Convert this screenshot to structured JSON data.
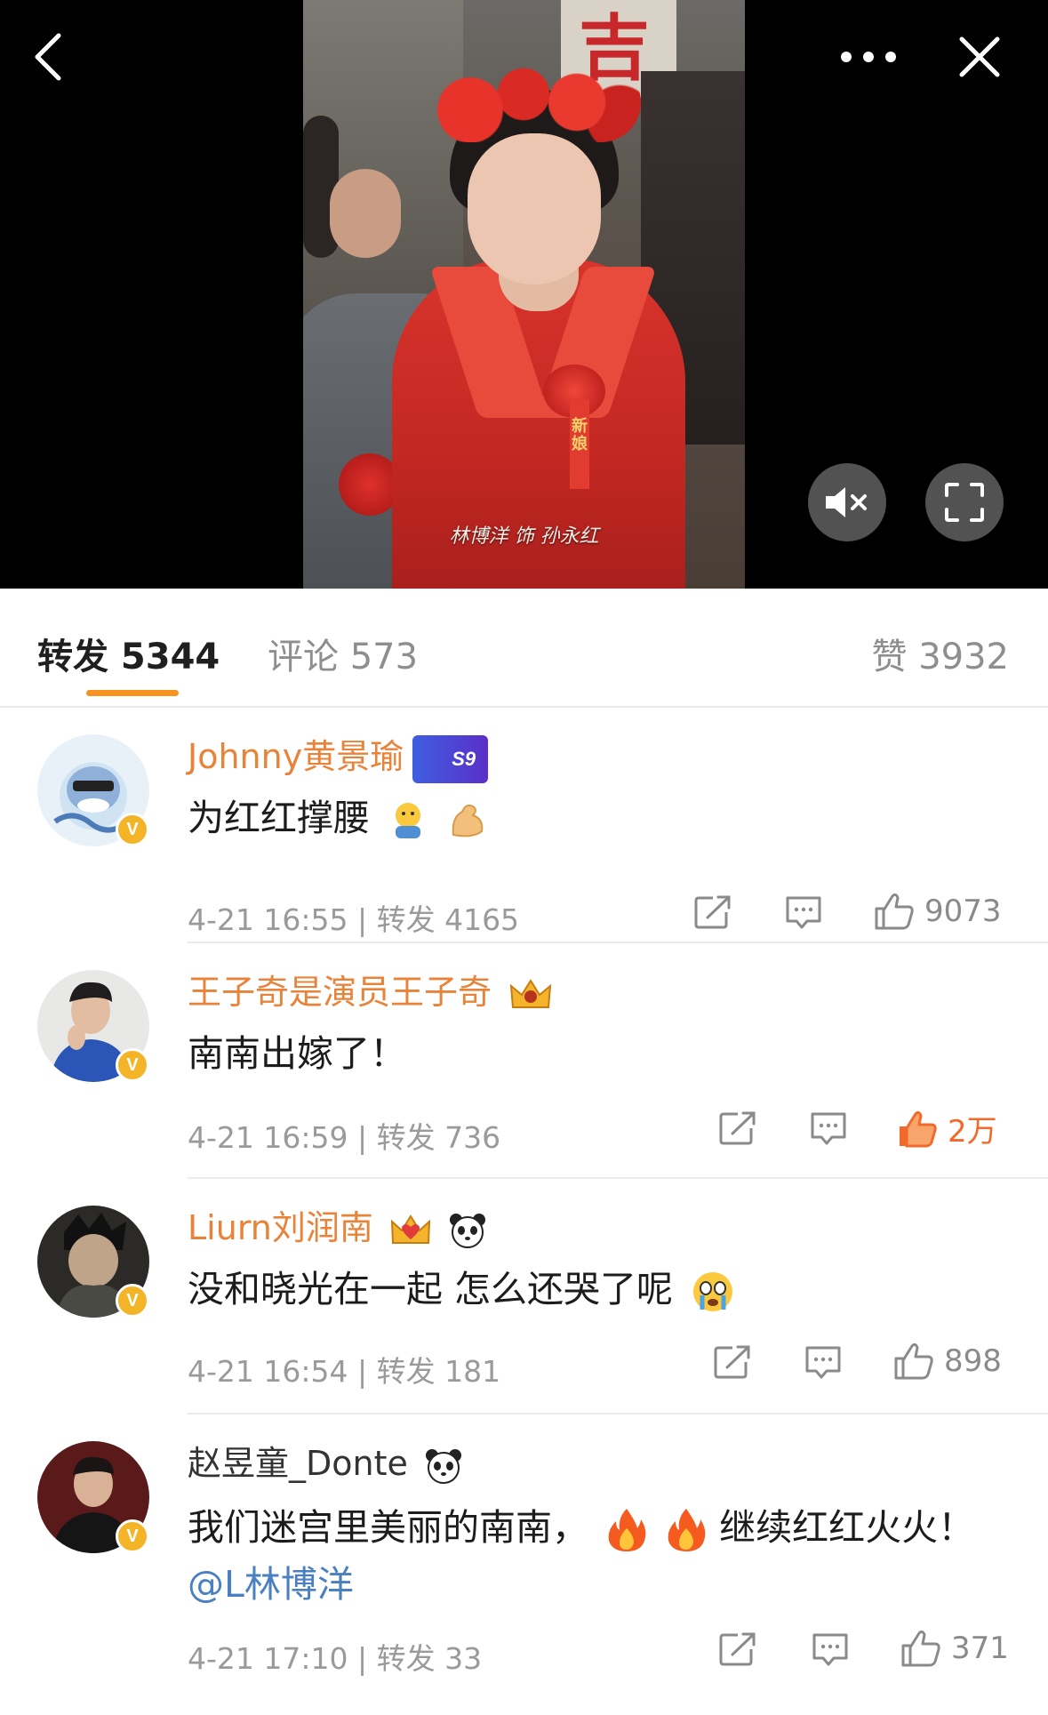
{
  "video": {
    "caption": "林博洋 饰 孙永红",
    "sign_char": "吉",
    "ribbon_text": "新娘"
  },
  "tabs": {
    "reposts": "转发 5344",
    "comments": "评论 573",
    "likes": "赞 3932"
  },
  "comments": [
    {
      "username": "Johnny黄景瑜",
      "badge_text": "S9",
      "avatar_badge": "V",
      "text": "为红红撑腰",
      "meta": "4-21 16:55 | 转发 4165",
      "likes": "9073",
      "liked": false
    },
    {
      "username": "王子奇是演员王子奇",
      "avatar_badge": "V",
      "text": "南南出嫁了！",
      "meta": "4-21 16:59 | 转发 736",
      "likes": "2万",
      "liked": true
    },
    {
      "username": "Liurn刘润南",
      "avatar_badge": "V",
      "text": "没和晓光在一起 怎么还哭了呢",
      "meta": "4-21 16:54 | 转发 181",
      "likes": "898",
      "liked": false
    },
    {
      "username": "赵昱童_Donte",
      "avatar_badge": "V",
      "text_before": "我们迷宫里美丽的南南，",
      "text_after": "继续红红火火！",
      "mention": "@L林博洋",
      "meta": "4-21 17:10 | 转发 33",
      "likes": "371",
      "liked": false
    }
  ],
  "icons": {
    "back": "chevron-left-icon",
    "more": "more-dots-icon",
    "close": "close-icon",
    "mute": "speaker-muted-icon",
    "fullscreen": "fullscreen-icon",
    "share": "share-icon",
    "reply": "comment-icon",
    "like": "thumbs-up-icon"
  },
  "colors": {
    "accent": "#f7931e",
    "username": "#e8833a",
    "liked": "#f26a2b",
    "link": "#4a7fc1"
  }
}
